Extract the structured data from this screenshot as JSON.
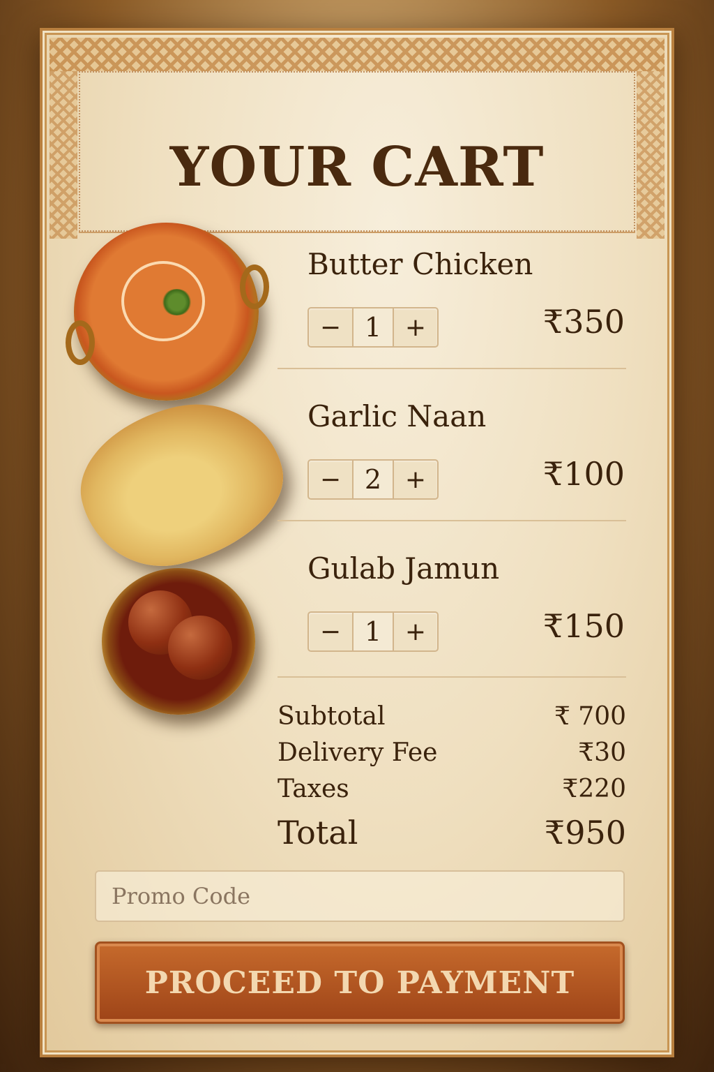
{
  "cart": {
    "title": "YOUR CART"
  },
  "items": [
    {
      "name": "Butter Chicken",
      "quantity": "1",
      "price": "₹350",
      "image": "butter-chicken-bowl"
    },
    {
      "name": "Garlic Naan",
      "quantity": "2",
      "price": "₹100",
      "image": "garlic-naan"
    },
    {
      "name": "Gulab Jamun",
      "quantity": "1",
      "price": "₹150",
      "image": "gulab-jamun-bowl"
    }
  ],
  "stepper": {
    "minus": "−",
    "plus": "+"
  },
  "summary": {
    "subtotal_label": "Subtotal",
    "subtotal_value": "₹ 700",
    "delivery_label": "Delivery Fee",
    "delivery_value": "₹30",
    "taxes_label": "Taxes",
    "taxes_value": "₹220",
    "total_label": "Total",
    "total_value": "₹950"
  },
  "promo": {
    "placeholder": "Promo Code"
  },
  "checkout": {
    "button_label": "PROCEED TO PAYMENT"
  },
  "colors": {
    "accent": "#b1541f",
    "text": "#3a220c",
    "parchment": "#f1e4c8"
  }
}
